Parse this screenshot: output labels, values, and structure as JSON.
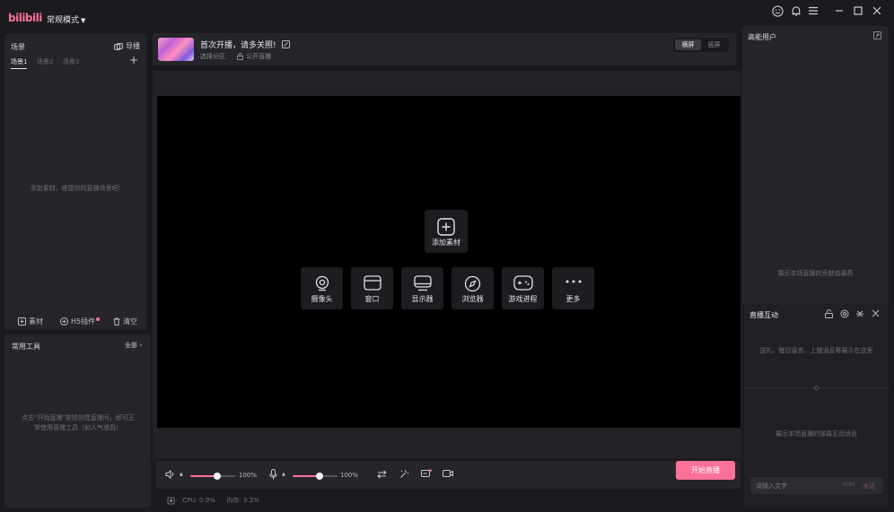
{
  "app": {
    "logo_text": "bilibili",
    "mode_label": "常规模式",
    "colors": {
      "accent": "#fb7299",
      "bg": "#1b1b1f",
      "panel": "#25252b"
    }
  },
  "titlebar": {
    "icons": [
      "smiley-icon",
      "bell-icon",
      "menu-icon",
      "minimize-icon",
      "maximize-icon",
      "close-icon"
    ]
  },
  "scene": {
    "title": "场景",
    "guide_label": "导播",
    "tabs": [
      "场景1",
      "场景2",
      "场景3"
    ],
    "empty_text": "添加素材，搭建你的直播场景吧!",
    "footer": {
      "material": "素材",
      "h5": "H5插件",
      "clear": "清空"
    }
  },
  "tools": {
    "title": "常用工具",
    "all_label": "全部",
    "hint": "点击\"开始直播\"按钮创建直播间，即可正常使用直播工具（如人气道具）"
  },
  "header": {
    "title": "首次开播，请多关照!",
    "category": "选择分区",
    "visibility": "公开直播",
    "orientation": [
      "横屏",
      "竖屏"
    ],
    "orientation_selected": "横屏"
  },
  "preview": {
    "add_material": "添加素材",
    "sources": [
      {
        "label": "摄像头",
        "icon": "camera-icon"
      },
      {
        "label": "窗口",
        "icon": "window-icon"
      },
      {
        "label": "显示器",
        "icon": "monitor-icon"
      },
      {
        "label": "浏览器",
        "icon": "compass-icon"
      },
      {
        "label": "游戏进程",
        "icon": "gamepad-icon"
      },
      {
        "label": "更多",
        "icon": "more-icon"
      }
    ]
  },
  "controls": {
    "speaker_volume": 100,
    "speaker_volume_text": "100%",
    "mic_volume": 100,
    "mic_volume_text": "100%",
    "start_label": "开始直播",
    "status": {
      "cpu": "CPU: 0.9%",
      "mem": "内存: 3.3%"
    }
  },
  "high_users": {
    "title": "高能用户",
    "hint": "展示本场直播的贡献值最高"
  },
  "interaction": {
    "title": "直播互动",
    "hint_top": "送礼、醒目留言、上舰消息等展示在这里",
    "hint_bottom": "展示本场直播的弹幕互动消息",
    "input_placeholder": "请输入文字",
    "char_count": "0/40",
    "send_label": "发送"
  }
}
